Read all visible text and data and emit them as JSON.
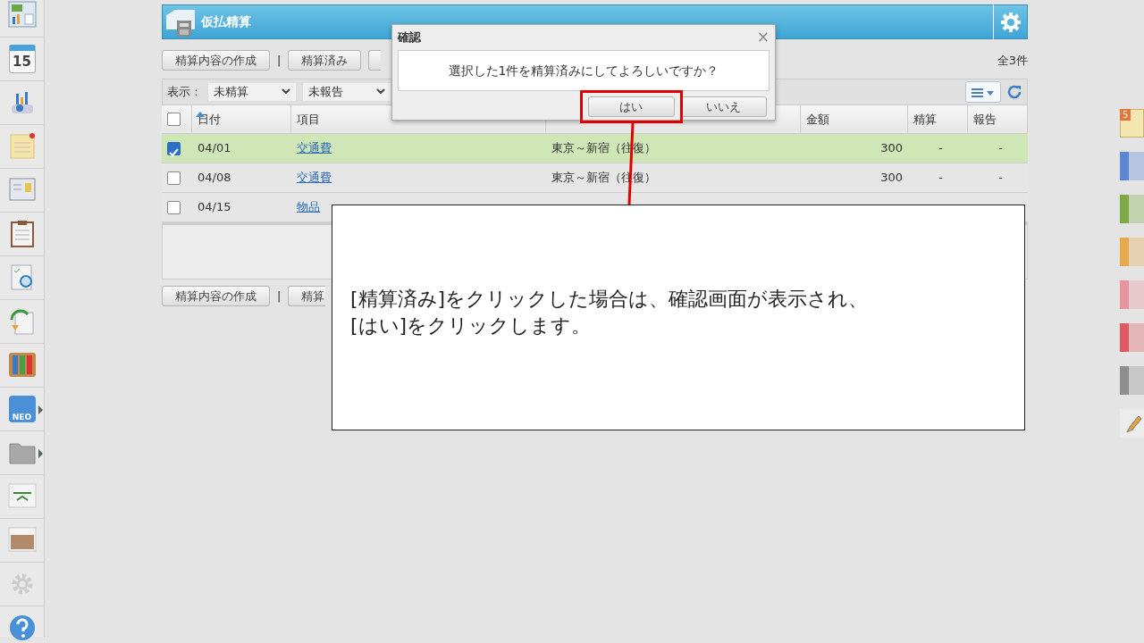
{
  "sidebar": {
    "items": [
      {
        "kind": "dashboard"
      },
      {
        "kind": "calendar",
        "label": "15"
      },
      {
        "kind": "chart"
      },
      {
        "kind": "memo"
      },
      {
        "kind": "board"
      },
      {
        "kind": "clipboard"
      },
      {
        "kind": "search-doc"
      },
      {
        "kind": "refresh-doc"
      },
      {
        "kind": "binders"
      },
      {
        "kind": "neo",
        "label": "NEO",
        "submenu": true
      },
      {
        "kind": "folder",
        "submenu": true
      },
      {
        "kind": "logo"
      },
      {
        "kind": "photo"
      },
      {
        "kind": "gear"
      },
      {
        "kind": "help"
      }
    ]
  },
  "panel": {
    "title": "仮払精算",
    "toolbar": [
      {
        "kind": "button",
        "label": "精算内容の作成"
      },
      {
        "kind": "separator",
        "label": "|"
      },
      {
        "kind": "button",
        "label": "精算済み"
      },
      {
        "kind": "covered"
      }
    ],
    "total": "全3件",
    "select_all_checked": false,
    "filter": {
      "label": "表示：",
      "selects": [
        "未精算",
        "未報告"
      ]
    },
    "columns": [
      "日付",
      "項目",
      "",
      "金額",
      "精算",
      "報告"
    ],
    "rows": [
      {
        "checked": true,
        "selected": true,
        "date": "04/01",
        "item": "交通費",
        "content": "東京～新宿（往復）",
        "amount": "300",
        "settled": "-",
        "reported": "-"
      },
      {
        "checked": false,
        "selected": false,
        "date": "04/08",
        "item": "交通費",
        "content": "東京～新宿（往復）",
        "amount": "300",
        "settled": "-",
        "reported": "-"
      },
      {
        "checked": false,
        "selected": false,
        "date": "04/15",
        "item": "物品",
        "content": "",
        "amount": "",
        "settled": "",
        "reported": ""
      }
    ],
    "bottom_toolbar": [
      {
        "kind": "button",
        "label": "精算内容の作成"
      },
      {
        "kind": "separator",
        "label": "|"
      },
      {
        "kind": "covered",
        "label": "精算"
      }
    ]
  },
  "dialog": {
    "title": "確認",
    "close": "×",
    "message": "選択した1件を精算済みにしてよろしいですか？",
    "buttons": [
      {
        "label": "はい",
        "highlighted": true
      },
      {
        "label": "いいえ",
        "highlighted": false
      }
    ]
  },
  "callout": {
    "lines": [
      "[精算済み]をクリックした場合は、確認画面が表示され、",
      "[はい]をクリックします。"
    ]
  },
  "right_panel": {
    "badge": "5",
    "tabs": [
      {
        "color": "#5b86d6"
      },
      {
        "color": "#7daa45"
      },
      {
        "color": "#e8a94a"
      },
      {
        "color": "#e8949e"
      },
      {
        "color": "#e05a5f"
      },
      {
        "color": "#8e8e8e"
      }
    ]
  }
}
